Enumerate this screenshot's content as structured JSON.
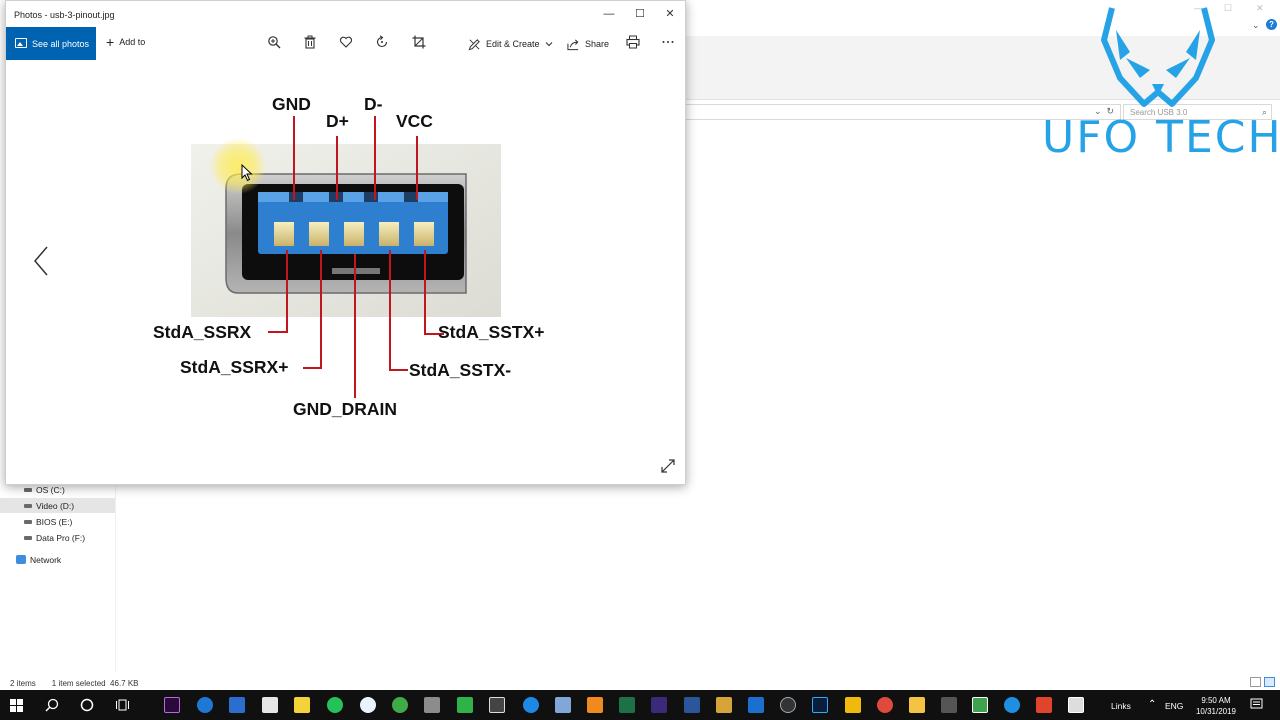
{
  "photos": {
    "title": "Photos - usb-3-pinout.jpg",
    "toolbar": {
      "see_all_label": "See all photos",
      "add_to_label": "Add to",
      "edit_create_label": "Edit & Create",
      "share_label": "Share"
    },
    "image": {
      "labels": {
        "gnd": "GND",
        "d_plus": "D+",
        "d_minus": "D-",
        "vcc": "VCC",
        "ssrx_minus": "StdA_SSRX",
        "ssrx_plus": "StdA_SSRX+",
        "gnd_drain": "GND_DRAIN",
        "sstx_minus": "StdA_SSTX-",
        "sstx_plus": "StdA_SSTX+"
      }
    }
  },
  "explorer": {
    "search_placeholder": "Search USB 3.0",
    "nav_items": [
      {
        "label": "OS (C:)"
      },
      {
        "label": "Video (D:)"
      },
      {
        "label": "BIOS (E:)"
      },
      {
        "label": "Data Pro (F:)"
      }
    ],
    "network_label": "Network",
    "status_items": "2 items",
    "status_selected": "1 item selected  46.7 KB"
  },
  "logo": {
    "text": "UFO TECH",
    "color": "#25a3e6"
  },
  "taskbar": {
    "links_label": "Links",
    "language": "ENG",
    "time": "9:50 AM",
    "date": "10/31/2019"
  }
}
